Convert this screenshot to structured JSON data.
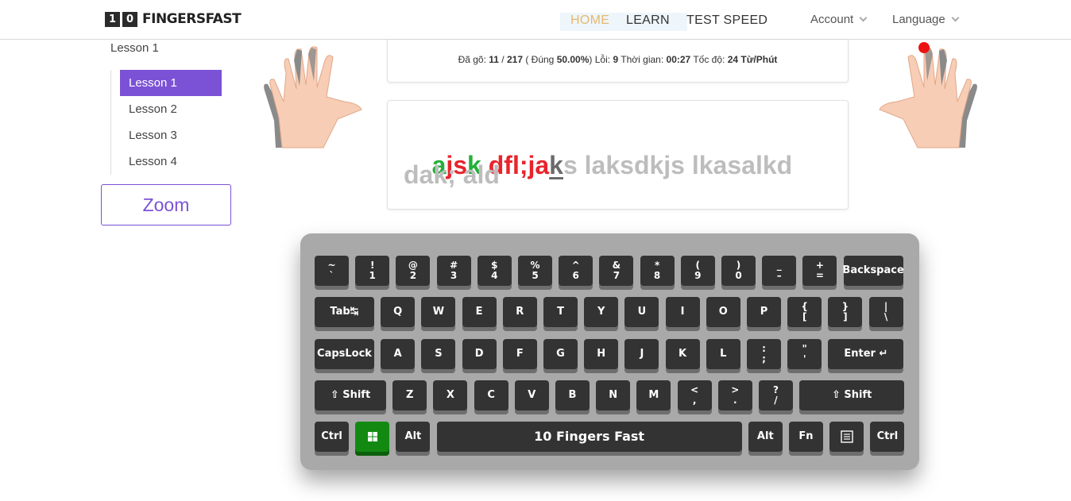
{
  "brand": {
    "digits": [
      "1",
      "0"
    ],
    "name": "FINGERSFAST"
  },
  "nav": {
    "home": "HOME",
    "learn": "LEARN",
    "test_speed": "TEST SPEED",
    "account": "Account",
    "language": "Language"
  },
  "sidebar": {
    "title": "Lesson 1",
    "items": [
      {
        "label": "Lesson 1",
        "active": true
      },
      {
        "label": "Lesson 2",
        "active": false
      },
      {
        "label": "Lesson 3",
        "active": false
      },
      {
        "label": "Lesson 4",
        "active": false
      }
    ],
    "zoom_label": "Zoom"
  },
  "stats": {
    "typed_label": "Đã gõ:",
    "typed": "11",
    "total": "217",
    "correct_label": "Đúng",
    "correct_pct": "50.00%",
    "errors_label": "Lỗi:",
    "errors": "9",
    "time_label": "Thời gian:",
    "time": "00:27",
    "speed_label": "Tốc độ:",
    "speed": "24 Từ/Phút"
  },
  "typing": {
    "line1": [
      {
        "text": "a",
        "state": "correct"
      },
      {
        "text": "js",
        "state": "wrong"
      },
      {
        "text": "k",
        "state": "correct"
      },
      {
        "text": " dfl;ja",
        "state": "wrong"
      },
      {
        "text": "k",
        "state": "current"
      },
      {
        "text": "s laksdkjs lkasalkd",
        "state": "pending"
      }
    ],
    "line2": "dak; ald"
  },
  "keyboard": {
    "colors": {
      "frame": "#a9a9a9",
      "key": "#333333",
      "win_key": "#128a12"
    },
    "rows": [
      [
        {
          "top": "~",
          "bottom": "`"
        },
        {
          "top": "!",
          "bottom": "1"
        },
        {
          "top": "@",
          "bottom": "2"
        },
        {
          "top": "#",
          "bottom": "3"
        },
        {
          "top": "$",
          "bottom": "4"
        },
        {
          "top": "%",
          "bottom": "5"
        },
        {
          "top": "^",
          "bottom": "6"
        },
        {
          "top": "&",
          "bottom": "7"
        },
        {
          "top": "*",
          "bottom": "8"
        },
        {
          "top": "(",
          "bottom": "9"
        },
        {
          "top": ")",
          "bottom": "0"
        },
        {
          "top": "_",
          "bottom": "–"
        },
        {
          "top": "+",
          "bottom": "="
        },
        {
          "label": "Backspace"
        }
      ],
      [
        {
          "label": "Tab↹"
        },
        {
          "label": "Q"
        },
        {
          "label": "W"
        },
        {
          "label": "E"
        },
        {
          "label": "R"
        },
        {
          "label": "T"
        },
        {
          "label": "Y"
        },
        {
          "label": "U"
        },
        {
          "label": "I"
        },
        {
          "label": "O"
        },
        {
          "label": "P"
        },
        {
          "top": "{",
          "bottom": "["
        },
        {
          "top": "}",
          "bottom": "]"
        },
        {
          "top": "|",
          "bottom": "\\"
        }
      ],
      [
        {
          "label": "CapsLock"
        },
        {
          "label": "A"
        },
        {
          "label": "S"
        },
        {
          "label": "D"
        },
        {
          "label": "F"
        },
        {
          "label": "G"
        },
        {
          "label": "H"
        },
        {
          "label": "J"
        },
        {
          "label": "K"
        },
        {
          "label": "L"
        },
        {
          "top": ":",
          "bottom": ";"
        },
        {
          "top": "\"",
          "bottom": "'"
        },
        {
          "label": "Enter ↵"
        }
      ],
      [
        {
          "label": "⇧ Shift"
        },
        {
          "label": "Z"
        },
        {
          "label": "X"
        },
        {
          "label": "C"
        },
        {
          "label": "V"
        },
        {
          "label": "B"
        },
        {
          "label": "N"
        },
        {
          "label": "M"
        },
        {
          "top": "<",
          "bottom": ","
        },
        {
          "top": ">",
          "bottom": "."
        },
        {
          "top": "?",
          "bottom": "/"
        },
        {
          "label": "⇧ Shift"
        }
      ],
      [
        {
          "label": "Ctrl"
        },
        {
          "label": "",
          "icon": "windows-icon"
        },
        {
          "label": "Alt"
        },
        {
          "label": "10 Fingers Fast"
        },
        {
          "label": "Alt"
        },
        {
          "label": "Fn"
        },
        {
          "label": "",
          "icon": "menu-icon"
        },
        {
          "label": "Ctrl"
        }
      ]
    ]
  }
}
